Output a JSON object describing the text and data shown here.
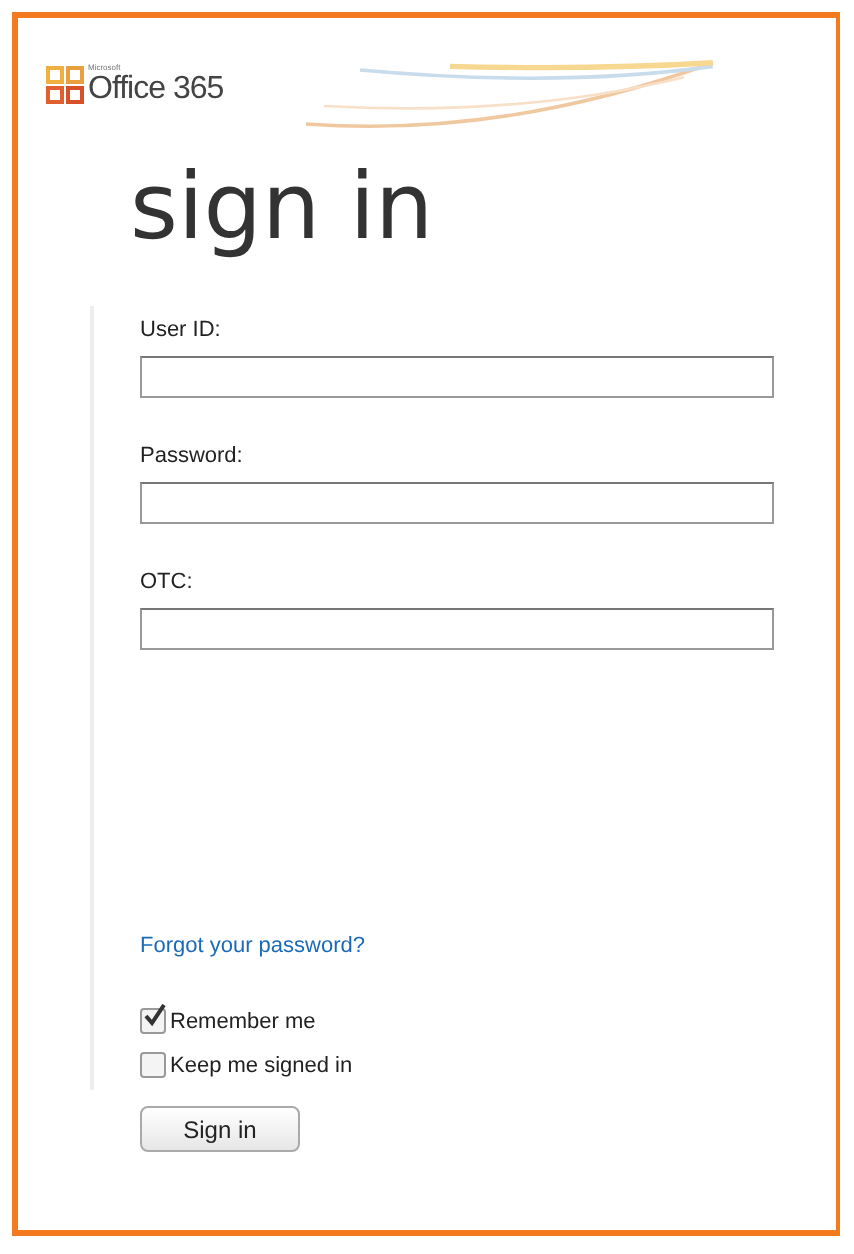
{
  "logo": {
    "company": "Microsoft",
    "product": "Office 365"
  },
  "heading": "sign in",
  "fields": [
    {
      "label": "User ID:"
    },
    {
      "label": "Password:"
    },
    {
      "label": "OTC:"
    }
  ],
  "forgot_link": "Forgot your password?",
  "options": [
    {
      "label": "Remember me",
      "checked": true
    },
    {
      "label": "Keep me signed in",
      "checked": false
    }
  ],
  "submit_button": "Sign in"
}
